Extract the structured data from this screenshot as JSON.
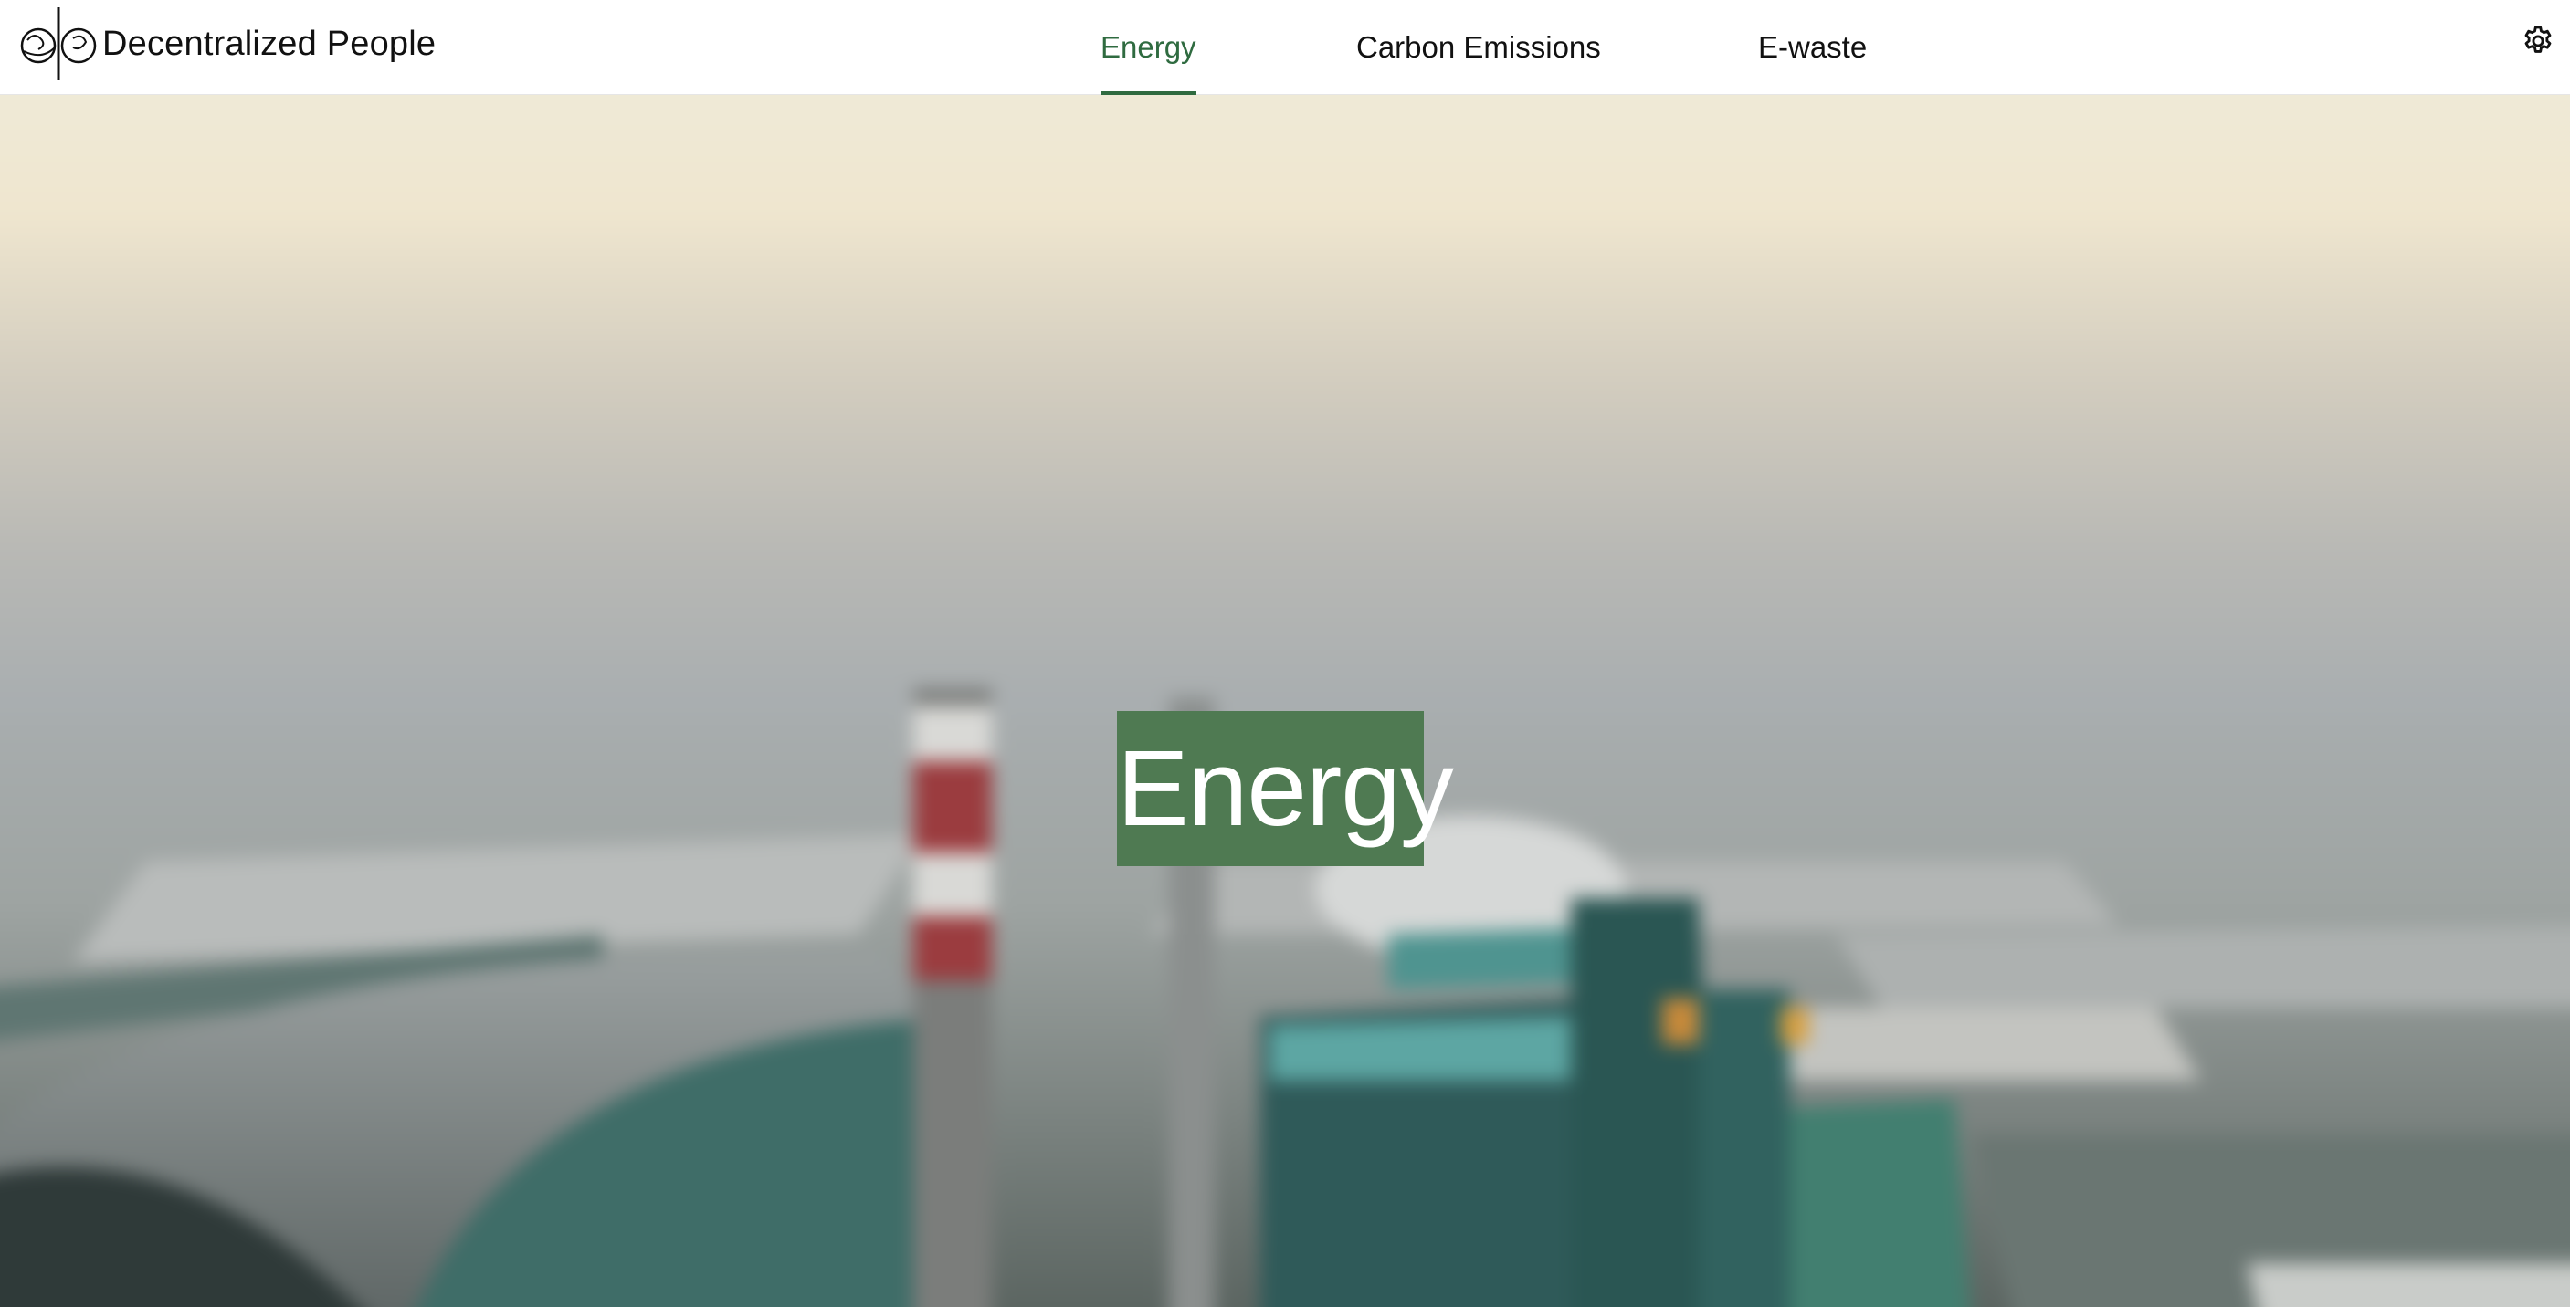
{
  "brand": {
    "name": "Decentralized People",
    "logo_icon": "dp-logo-icon"
  },
  "nav": {
    "tabs": [
      {
        "label": "Energy",
        "active": true
      },
      {
        "label": "Carbon Emissions",
        "active": false
      },
      {
        "label": "E-waste",
        "active": false
      }
    ],
    "settings_icon": "gear-icon"
  },
  "hero": {
    "title": "Energy",
    "background_image": "blurred-power-plant-photo"
  },
  "colors": {
    "accent": "#2f6b40",
    "title_bg": "#4f7a52",
    "nav_bg": "#ffffff",
    "nav_text": "#111111"
  }
}
